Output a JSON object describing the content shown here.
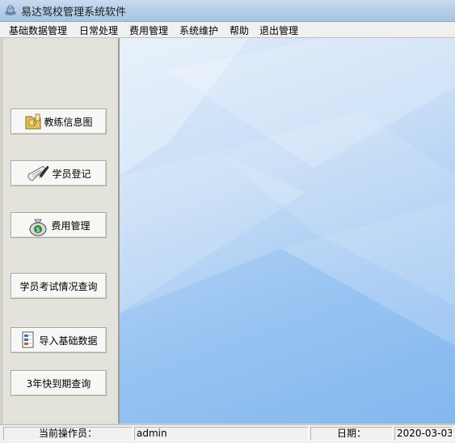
{
  "window": {
    "title": "易达驾校管理系统软件",
    "icon": "app-icon"
  },
  "menu": [
    {
      "label": "基础数据管理"
    },
    {
      "label": "日常处理"
    },
    {
      "label": "费用管理"
    },
    {
      "label": "系统维护"
    },
    {
      "label": "帮助"
    },
    {
      "label": "退出管理"
    }
  ],
  "sidebar": {
    "buttons": [
      {
        "label": "教练信息图",
        "icon": "folder-puzzle-icon"
      },
      {
        "label": "学员登记",
        "icon": "scroll-pen-icon"
      },
      {
        "label": "费用管理",
        "icon": "money-bag-icon"
      },
      {
        "label": "学员考试情况查询",
        "icon": ""
      },
      {
        "label": "导入基础数据",
        "icon": "document-icon"
      },
      {
        "label": "3年快到期查询",
        "icon": ""
      }
    ]
  },
  "statusbar": {
    "operator_label": "当前操作员：",
    "operator_value": "admin",
    "date_label": "日期：",
    "date_value": "2020-03-03"
  },
  "colors": {
    "workspace_gradient_start": "#e0ecfa",
    "workspace_gradient_end": "#8bbcef",
    "panel_bg": "#e3e3dc"
  }
}
